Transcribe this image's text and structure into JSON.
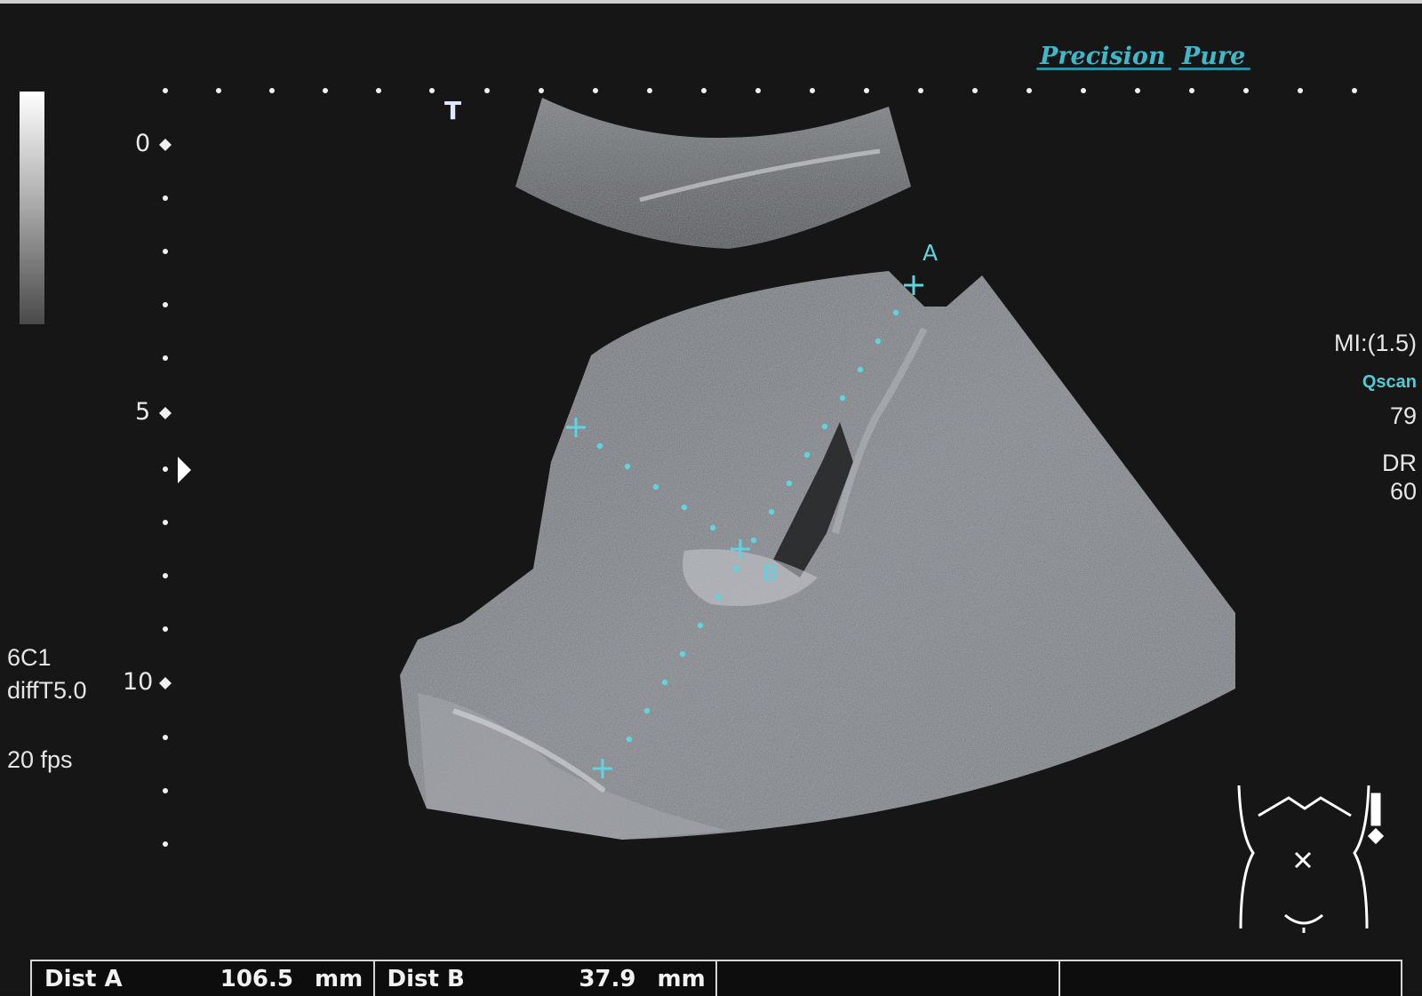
{
  "brand": {
    "precision": "Precision",
    "pure": "Pure",
    "accent_color": "#3fb8c9"
  },
  "transducer_marker": "T",
  "depth_scale": {
    "labels": [
      "0",
      "5",
      "10"
    ]
  },
  "left_info": {
    "probe": "6C1",
    "preset": "diffT5.0",
    "frame_rate": "20 fps"
  },
  "right_info": {
    "mi": "MI:(1.5)",
    "qscan_label": "Qscan",
    "qscan_value": "79",
    "dr_label": "DR",
    "dr_value": "60"
  },
  "measurements": {
    "labels": [
      "A",
      "B"
    ],
    "caliper_color": "#5fd3df"
  },
  "status_bar": {
    "cells": [
      {
        "key": "Dist A",
        "value": "106.5",
        "unit": "mm"
      },
      {
        "key": "Dist B",
        "value": "37.9",
        "unit": "mm"
      },
      {
        "key": "",
        "value": "",
        "unit": ""
      },
      {
        "key": "",
        "value": "",
        "unit": ""
      }
    ]
  },
  "body_marker_icon": "abdomen-body-marker-icon"
}
